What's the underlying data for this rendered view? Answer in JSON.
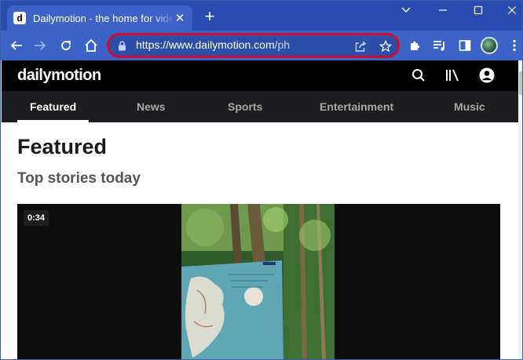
{
  "browser": {
    "tab": {
      "favicon_letter": "d",
      "title": "Dailymotion - the home for videos",
      "close_glyph": "✕"
    },
    "new_tab_glyph": "+",
    "address": {
      "host": "https://www.dailymotion.com",
      "path": "/ph"
    },
    "icons": {
      "back": "back-arrow-icon",
      "forward": "forward-arrow-icon",
      "reload": "reload-icon",
      "home": "home-icon",
      "lock": "lock-icon",
      "share": "share-icon",
      "bookmark": "star-icon",
      "extensions": "puzzle-icon",
      "media": "media-queue-icon",
      "side_panel": "side-panel-icon",
      "profile": "profile-avatar",
      "menu": "kebab-menu-icon"
    },
    "colors": {
      "tabstrip": "#2a4bb0",
      "toolbar": "#3e63c6",
      "omnibox_highlight": "#c8102e"
    }
  },
  "site": {
    "logo": "dailymotion",
    "header_icons": [
      "search-icon",
      "library-icon",
      "account-icon"
    ],
    "nav": [
      {
        "label": "Featured",
        "active": true
      },
      {
        "label": "News",
        "active": false
      },
      {
        "label": "Sports",
        "active": false
      },
      {
        "label": "Entertainment",
        "active": false
      },
      {
        "label": "Music",
        "active": false
      }
    ],
    "page_title": "Featured",
    "section_title": "Top stories today",
    "video": {
      "duration": "0:34"
    }
  }
}
